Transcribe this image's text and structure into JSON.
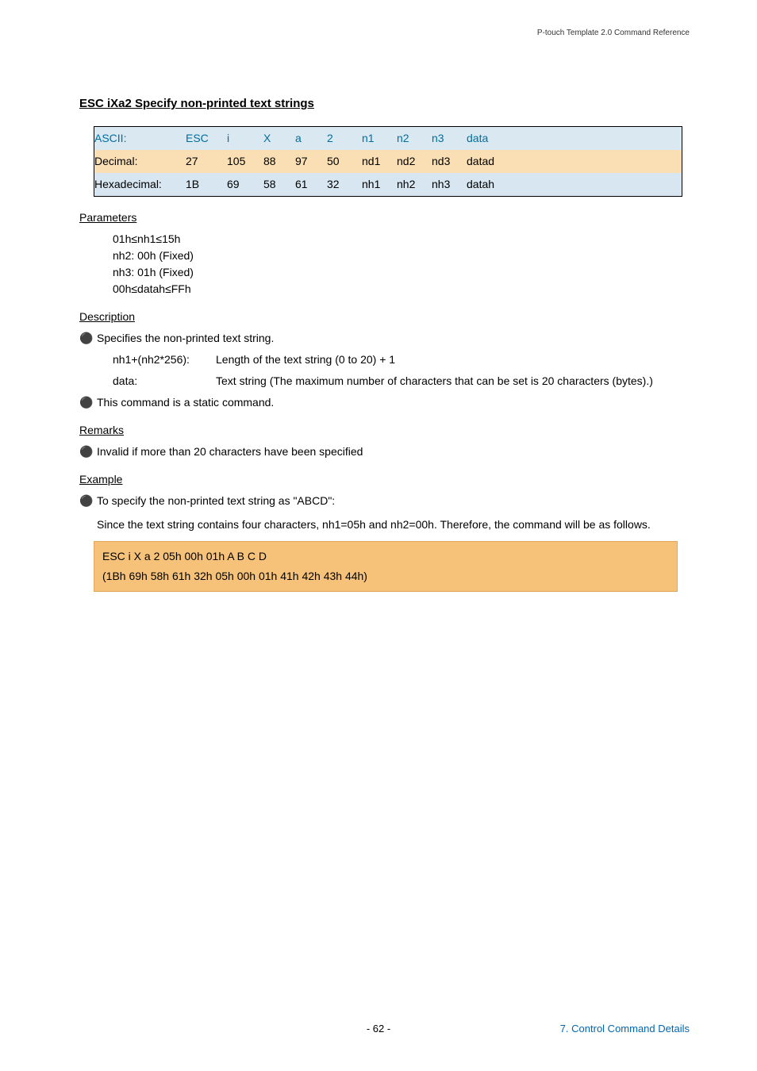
{
  "header": {
    "doc_ref": "P-touch Template 2.0 Command Reference"
  },
  "title": "ESC iXa2   Specify non-printed text strings",
  "table": {
    "row_ascii": {
      "label": "ASCII:",
      "v": [
        "ESC",
        "i",
        "X",
        "a",
        "2",
        "n1",
        "n2",
        "n3",
        "data"
      ]
    },
    "row_dec": {
      "label": "Decimal:",
      "v": [
        "27",
        "105",
        "88",
        "97",
        "50",
        "nd1",
        "nd2",
        "nd3",
        "datad"
      ]
    },
    "row_hex": {
      "label": "Hexadecimal:",
      "v": [
        "1B",
        "69",
        "58",
        "61",
        "32",
        "nh1",
        "nh2",
        "nh3",
        "datah"
      ]
    }
  },
  "sections": {
    "params_h": "Parameters",
    "params": [
      "01h≤nh1≤15h",
      "nh2: 00h (Fixed)",
      "nh3: 01h (Fixed)",
      "00h≤datah≤FFh"
    ],
    "desc_h": "Description",
    "desc_b1": "Specifies the non-printed text string.",
    "desc_def1_k": "nh1+(nh2*256):",
    "desc_def1_v": "Length of the text string (0 to 20) + 1",
    "desc_def2_k": "data:",
    "desc_def2_v": "Text string (The maximum number of characters that can be set is 20 characters (bytes).)",
    "desc_b2": "This command is a static command.",
    "rem_h": "Remarks",
    "rem_b1": "Invalid if more than 20 characters have been specified",
    "ex_h": "Example",
    "ex_b1": "To specify the non-printed text string as \"ABCD\":",
    "ex_p": "Since the text string contains four characters, nh1=05h and nh2=00h. Therefore, the command will be as follows.",
    "ex_box_l1": "ESC i X a 2 05h 00h 01h A B C D",
    "ex_box_l2": "(1Bh 69h 58h 61h 32h 05h 00h 01h 41h 42h 43h 44h)"
  },
  "footer": {
    "page": "- 62 -",
    "section": "7. Control Command Details"
  }
}
